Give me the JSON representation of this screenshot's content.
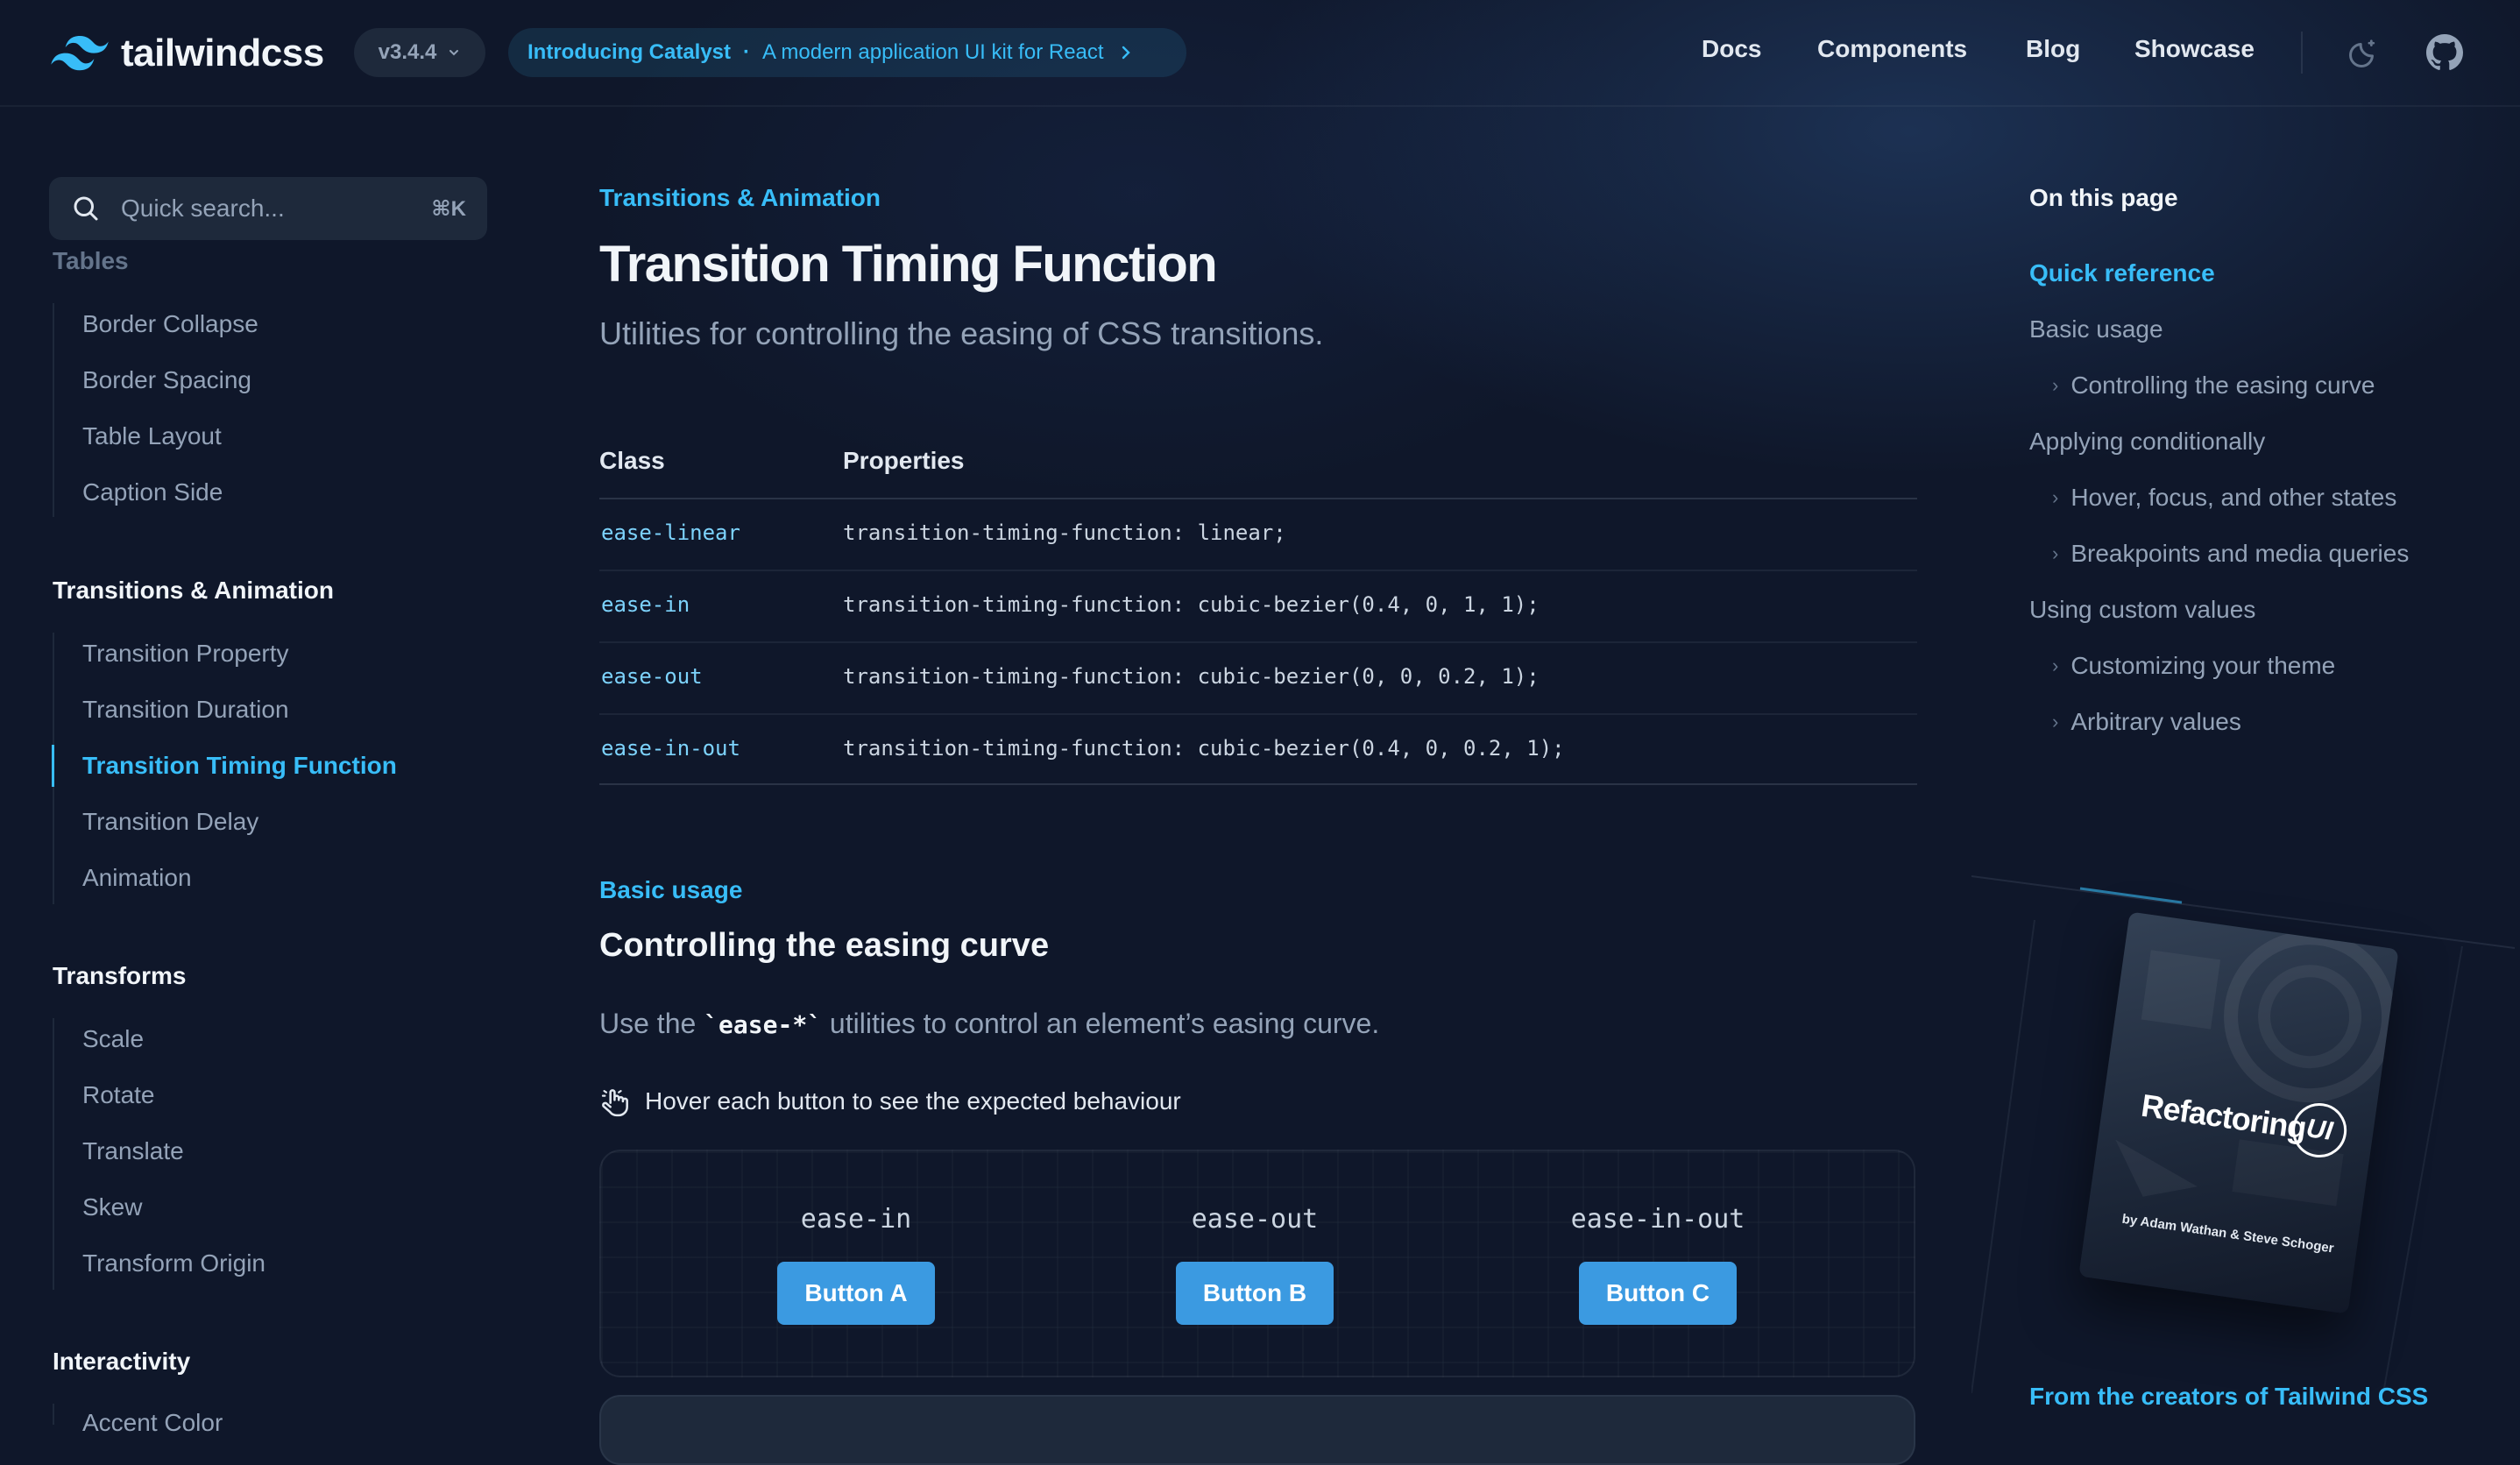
{
  "header": {
    "logo_text": "tailwindcss",
    "version": "v3.4.4",
    "promo": {
      "title": "Introducing Catalyst",
      "separator": "·",
      "subtitle": "A modern application UI kit for React"
    },
    "nav": [
      "Docs",
      "Components",
      "Blog",
      "Showcase"
    ]
  },
  "sidebar": {
    "search_placeholder": "Quick search...",
    "search_shortcut": "⌘K",
    "faded_section": "Tables",
    "tables_items": [
      "Border Collapse",
      "Border Spacing",
      "Table Layout",
      "Caption Side"
    ],
    "transitions_title": "Transitions & Animation",
    "transitions_items": [
      "Transition Property",
      "Transition Duration",
      "Transition Timing Function",
      "Transition Delay",
      "Animation"
    ],
    "transforms_title": "Transforms",
    "transforms_items": [
      "Scale",
      "Rotate",
      "Translate",
      "Skew",
      "Transform Origin"
    ],
    "interactivity_title": "Interactivity",
    "interactivity_items": [
      "Accent Color"
    ]
  },
  "main": {
    "eyebrow": "Transitions & Animation",
    "title": "Transition Timing Function",
    "lead": "Utilities for controlling the easing of CSS transitions.",
    "table": {
      "headers": [
        "Class",
        "Properties"
      ],
      "rows": [
        {
          "class": "ease-linear",
          "property": "transition-timing-function: linear;"
        },
        {
          "class": "ease-in",
          "property": "transition-timing-function: cubic-bezier(0.4, 0, 1, 1);"
        },
        {
          "class": "ease-out",
          "property": "transition-timing-function: cubic-bezier(0, 0, 0.2, 1);"
        },
        {
          "class": "ease-in-out",
          "property": "transition-timing-function: cubic-bezier(0.4, 0, 0.2, 1);"
        }
      ]
    },
    "section_eyebrow": "Basic usage",
    "section_title": "Controlling the easing curve",
    "paragraph_before": "Use the ",
    "paragraph_code": "`ease-*`",
    "paragraph_after": " utilities to control an element’s easing curve.",
    "hint": "Hover each button to see the expected behaviour",
    "demo": [
      {
        "label": "ease-in",
        "button": "Button A"
      },
      {
        "label": "ease-out",
        "button": "Button B"
      },
      {
        "label": "ease-in-out",
        "button": "Button C"
      }
    ]
  },
  "toc": {
    "title": "On this page",
    "items": [
      {
        "label": "Quick reference",
        "level": 1,
        "active": true
      },
      {
        "label": "Basic usage",
        "level": 1
      },
      {
        "label": "Controlling the easing curve",
        "level": 2
      },
      {
        "label": "Applying conditionally",
        "level": 1
      },
      {
        "label": "Hover, focus, and other states",
        "level": 2
      },
      {
        "label": "Breakpoints and media queries",
        "level": 2
      },
      {
        "label": "Using custom values",
        "level": 1
      },
      {
        "label": "Customizing your theme",
        "level": 2
      },
      {
        "label": "Arbitrary values",
        "level": 2
      }
    ]
  },
  "ad": {
    "book_title": "Refactoring",
    "book_badge": "UI",
    "book_authors_prefix": "by",
    "book_authors": "Adam Wathan & Steve Schoger",
    "caption": "From the creators of Tailwind CSS"
  },
  "colors": {
    "accent": "#38bdf8",
    "background": "#0f172a",
    "button": "#3b9ae1"
  }
}
